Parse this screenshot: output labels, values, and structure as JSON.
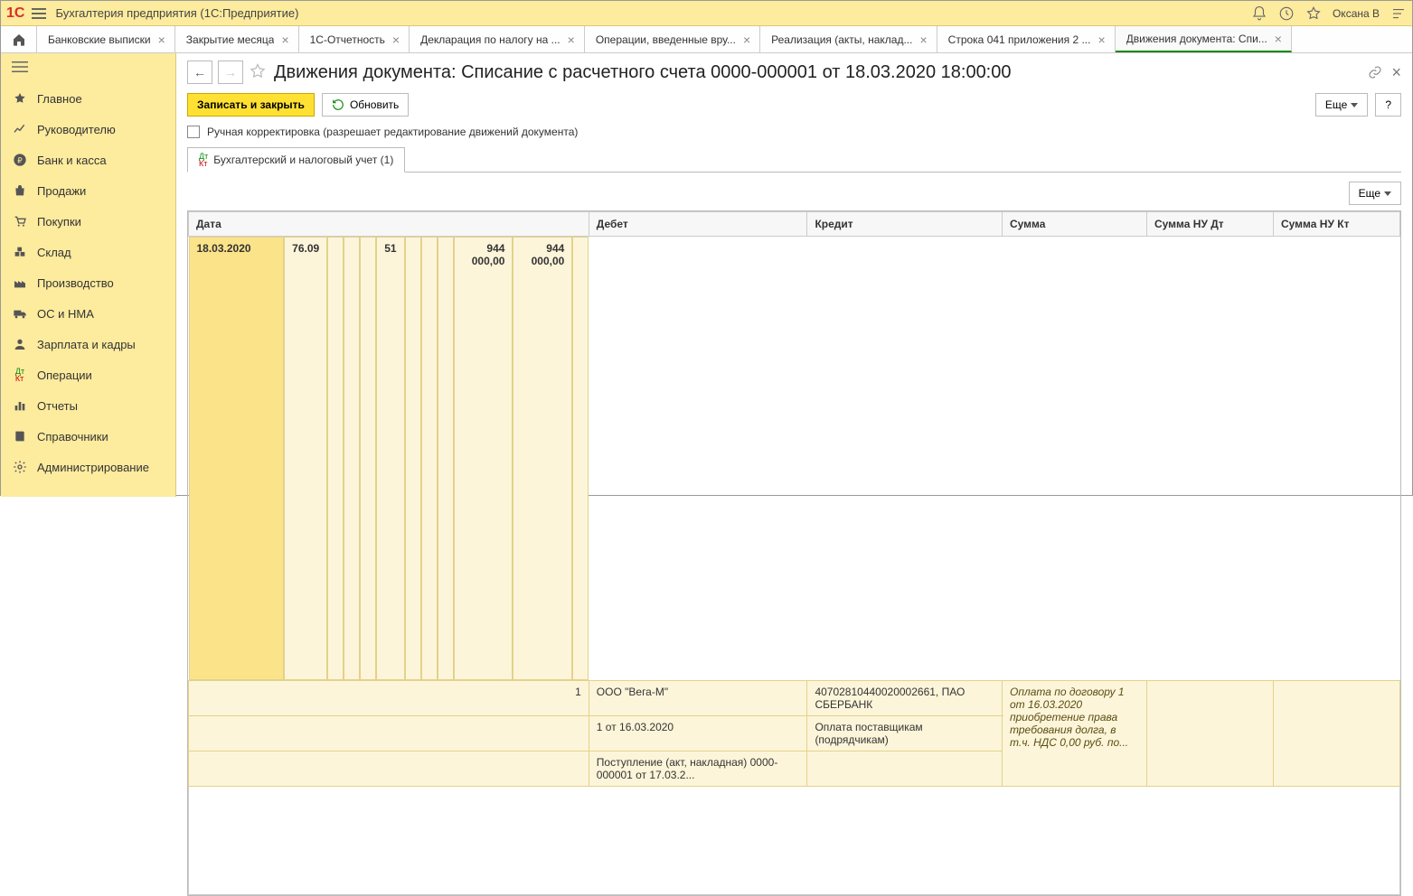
{
  "titlebar": {
    "app_title": "Бухгалтерия предприятия   (1С:Предприятие)",
    "user": "Оксана В"
  },
  "tabs": [
    {
      "label": "Банковские выписки"
    },
    {
      "label": "Закрытие месяца"
    },
    {
      "label": "1С-Отчетность"
    },
    {
      "label": "Декларация по налогу на ..."
    },
    {
      "label": "Операции, введенные вру..."
    },
    {
      "label": "Реализация (акты, наклад..."
    },
    {
      "label": "Строка 041 приложения 2 ..."
    },
    {
      "label": "Движения документа: Спи...",
      "active": true
    }
  ],
  "sidebar": [
    {
      "icon": "home",
      "label": "Главное"
    },
    {
      "icon": "chart",
      "label": "Руководителю"
    },
    {
      "icon": "ruble",
      "label": "Банк и касса"
    },
    {
      "icon": "bag",
      "label": "Продажи"
    },
    {
      "icon": "cart",
      "label": "Покупки"
    },
    {
      "icon": "box",
      "label": "Склад"
    },
    {
      "icon": "factory",
      "label": "Производство"
    },
    {
      "icon": "truck",
      "label": "ОС и НМА"
    },
    {
      "icon": "person",
      "label": "Зарплата и кадры"
    },
    {
      "icon": "dtkt",
      "label": "Операции"
    },
    {
      "icon": "bars",
      "label": "Отчеты"
    },
    {
      "icon": "book",
      "label": "Справочники"
    },
    {
      "icon": "gear",
      "label": "Администрирование"
    }
  ],
  "page": {
    "title": "Движения документа: Списание с расчетного счета 0000-000001 от 18.03.2020 18:00:00",
    "save_close": "Записать и закрыть",
    "refresh": "Обновить",
    "more": "Еще",
    "help": "?",
    "checkbox_label": "Ручная корректировка (разрешает редактирование движений документа)",
    "inner_tab": "Бухгалтерский и налоговый учет (1)"
  },
  "table": {
    "headers": {
      "date": "Дата",
      "debit": "Дебет",
      "credit": "Кредит",
      "sum": "Сумма",
      "sum_nu_dt": "Сумма НУ Дт",
      "sum_nu_kt": "Сумма НУ Кт"
    },
    "row": {
      "date": "18.03.2020",
      "seq": "1",
      "debit_acc": "76.09",
      "credit_acc": "51",
      "sum": "944 000,00",
      "sum_nu_dt": "944 000,00",
      "sum_nu_kt": "",
      "debit_line1": "ООО \"Вега-М\"",
      "debit_line2": "1 от 16.03.2020",
      "debit_line3": "Поступление (акт, накладная) 0000-000001 от 17.03.2...",
      "credit_line1": "40702810440020002661, ПАО СБЕРБАНК",
      "credit_line2": "Оплата поставщикам (подрядчикам)",
      "desc": "Оплата по договору 1 от 16.03.2020 приобретение права требования долга, в т.ч. НДС 0,00 руб. по..."
    }
  }
}
